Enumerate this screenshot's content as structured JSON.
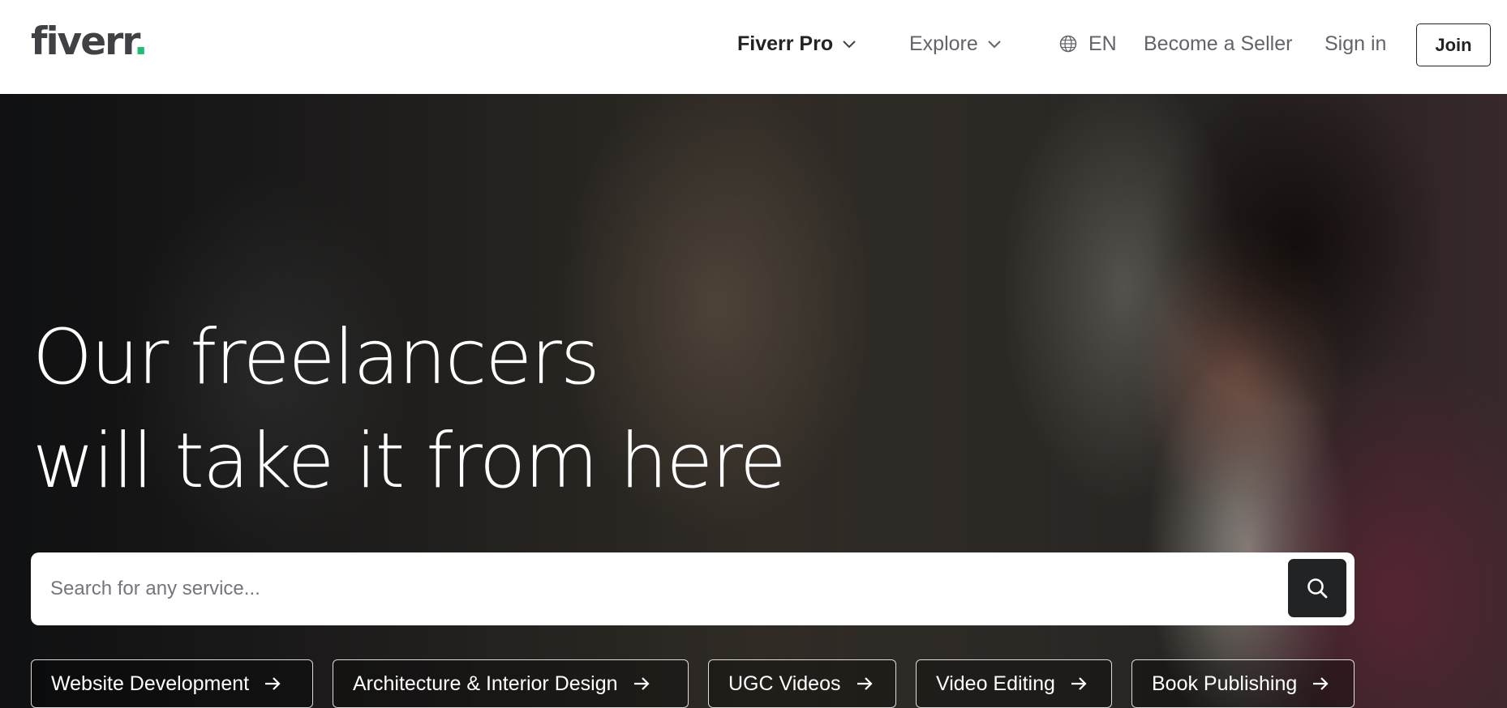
{
  "header": {
    "logo_text": "fiverr",
    "logo_dot": ".",
    "nav": {
      "fiverr_pro": "Fiverr Pro",
      "explore": "Explore",
      "language": "EN",
      "become_seller": "Become a Seller",
      "sign_in": "Sign in",
      "join": "Join"
    }
  },
  "hero": {
    "headline_line1": "Our freelancers",
    "headline_line2": "will take it from here",
    "search": {
      "placeholder": "Search for any service..."
    },
    "categories": [
      "Website Development",
      "Architecture & Interior Design",
      "UGC Videos",
      "Video Editing",
      "Book Publishing"
    ]
  },
  "colors": {
    "brand_green": "#1dbf73",
    "text_dark": "#222325",
    "text_gray": "#62646a"
  }
}
